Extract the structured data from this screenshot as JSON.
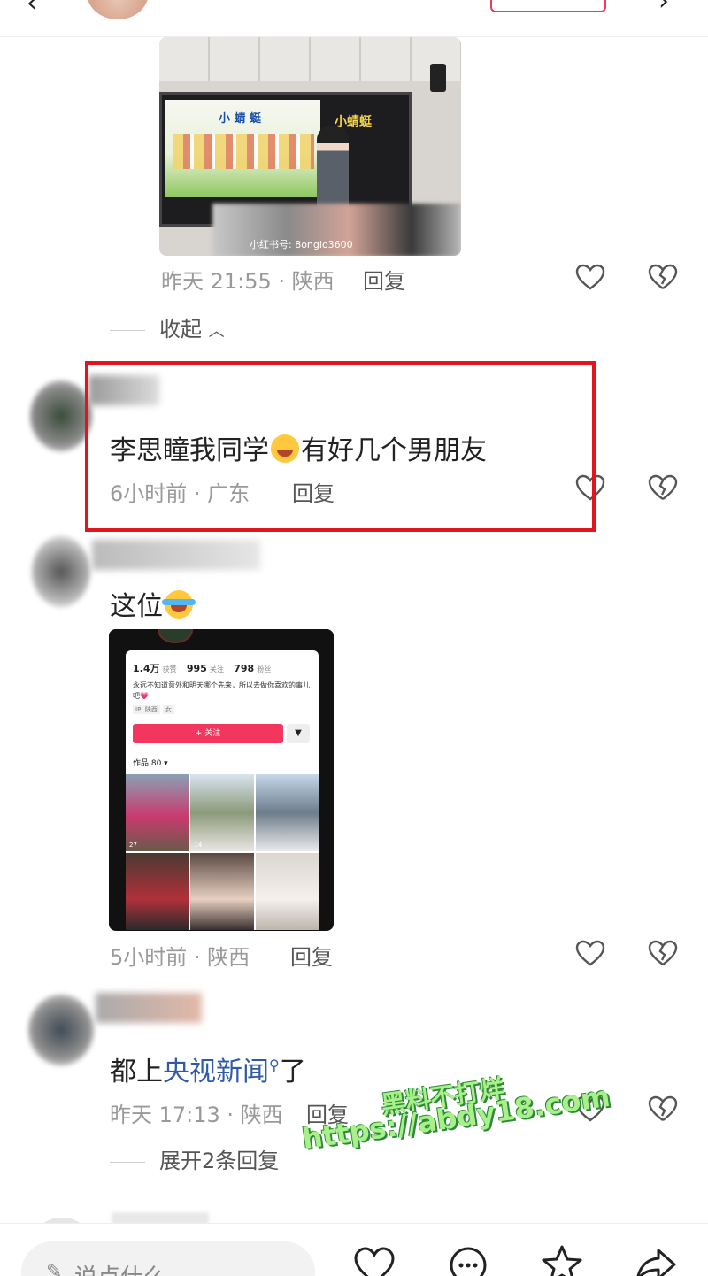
{
  "comments": {
    "first": {
      "meta": "昨天 21:55 · 陕西",
      "reply": "回复",
      "image_watermark": "小红书号: 8ongio3600",
      "slide_title": "小 蜻 蜓",
      "side_text": "小蜻蜓"
    },
    "collapse_label": "收起",
    "second": {
      "text_before": "李思瞳我同学",
      "text_after": "有好几个男朋友",
      "meta": "6小时前 · 广东",
      "reply": "回复"
    },
    "third": {
      "text": "这位",
      "meta": "5小时前 · 陕西",
      "reply": "回复",
      "profile": {
        "likes_num": "1.4万",
        "likes_label": "获赞",
        "following_num": "995",
        "following_label": "关注",
        "fans_num": "798",
        "fans_label": "粉丝",
        "bio": "永远不知道意外和明天哪个先来，所以去做你喜欢的事儿吧💗",
        "tag_ip": "IP: 陕西",
        "tag_gender": "女",
        "follow_btn": "+ 关注",
        "works_label": "作品 80 ▾",
        "counts": [
          "27",
          "14",
          "",
          "",
          "",
          ""
        ]
      }
    },
    "fourth": {
      "text_before": "都上",
      "link": "央视新闻",
      "text_after": "了",
      "meta": "昨天 17:13 · 陕西",
      "reply": "回复"
    },
    "expand_label": "展开2条回复"
  },
  "watermark": {
    "line1": "黑料不打烊",
    "line2": "https://abdy18.com"
  },
  "bottombar": {
    "input_placeholder": "说点什么"
  },
  "colors": {
    "highlight": "#e1151d",
    "link": "#2f5aa8",
    "follow": "#f2365d"
  },
  "icons": [
    "back-icon",
    "more-icon",
    "heart-icon",
    "broken-heart-icon",
    "chevron-up-icon",
    "search-icon",
    "chat-icon",
    "star-icon",
    "share-icon",
    "pen-icon"
  ]
}
